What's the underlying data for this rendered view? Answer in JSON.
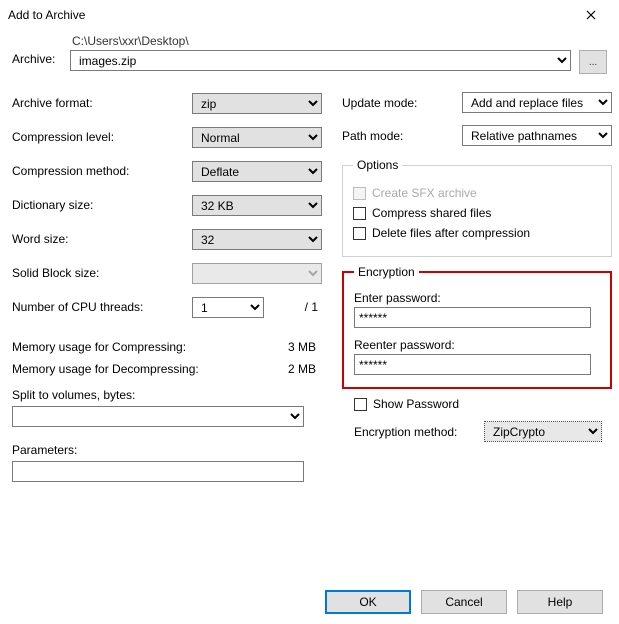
{
  "window": {
    "title": "Add to Archive"
  },
  "archive": {
    "label": "Archive:",
    "path": "C:\\Users\\xxr\\Desktop\\",
    "filename": "images.zip",
    "browse": "..."
  },
  "left": {
    "format_label": "Archive format:",
    "format_value": "zip",
    "level_label": "Compression level:",
    "level_value": "Normal",
    "method_label": "Compression method:",
    "method_value": "Deflate",
    "dict_label": "Dictionary size:",
    "dict_value": "32 KB",
    "word_label": "Word size:",
    "word_value": "32",
    "block_label": "Solid Block size:",
    "block_value": "",
    "cpu_label": "Number of CPU threads:",
    "cpu_value": "1",
    "cpu_total": "/ 1",
    "mem_comp_label": "Memory usage for Compressing:",
    "mem_comp_value": "3 MB",
    "mem_decomp_label": "Memory usage for Decompressing:",
    "mem_decomp_value": "2 MB",
    "split_label": "Split to volumes, bytes:",
    "split_value": "",
    "params_label": "Parameters:",
    "params_value": ""
  },
  "right": {
    "update_label": "Update mode:",
    "update_value": "Add and replace files",
    "path_label": "Path mode:",
    "path_value": "Relative pathnames",
    "options_legend": "Options",
    "opt_sfx": "Create SFX archive",
    "opt_shared": "Compress shared files",
    "opt_delete": "Delete files after compression",
    "enc_legend": "Encryption",
    "enc_enter": "Enter password:",
    "enc_pw1": "******",
    "enc_reenter": "Reenter password:",
    "enc_pw2": "******",
    "enc_show": "Show Password",
    "enc_method_label": "Encryption method:",
    "enc_method_value": "ZipCrypto"
  },
  "buttons": {
    "ok": "OK",
    "cancel": "Cancel",
    "help": "Help"
  }
}
